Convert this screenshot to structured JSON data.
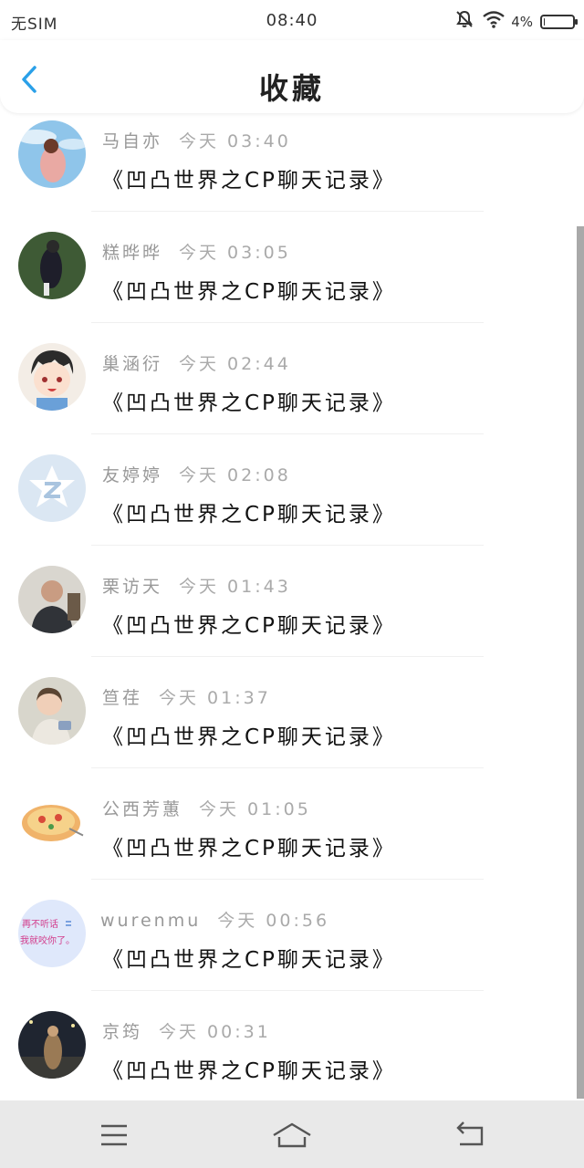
{
  "status_bar": {
    "carrier": "无SIM",
    "time": "08:40",
    "battery_text": "4%",
    "battery_level": 0.04
  },
  "header": {
    "title": "收藏",
    "accent_color": "#2aa0e8"
  },
  "items": [
    {
      "name": "马自亦",
      "time": "今天 03:40",
      "title": "《凹凸世界之CP聊天记录》",
      "avatar_icon": "avatar-photo-icon"
    },
    {
      "name": "糕晔晔",
      "time": "今天 03:05",
      "title": "《凹凸世界之CP聊天记录》",
      "avatar_icon": "avatar-photo-icon"
    },
    {
      "name": "巢涵衍",
      "time": "今天 02:44",
      "title": "《凹凸世界之CP聊天记录》",
      "avatar_icon": "avatar-cartoon-icon"
    },
    {
      "name": "友婷婷",
      "time": "今天 02:08",
      "title": "《凹凸世界之CP聊天记录》",
      "avatar_icon": "avatar-default-icon"
    },
    {
      "name": "栗访天",
      "time": "今天 01:43",
      "title": "《凹凸世界之CP聊天记录》",
      "avatar_icon": "avatar-photo-icon"
    },
    {
      "name": "笪荏",
      "time": "今天 01:37",
      "title": "《凹凸世界之CP聊天记录》",
      "avatar_icon": "avatar-photo-icon"
    },
    {
      "name": "公西芳蕙",
      "time": "今天 01:05",
      "title": "《凹凸世界之CP聊天记录》",
      "avatar_icon": "avatar-pizza-icon"
    },
    {
      "name": "wurenmu",
      "time": "今天 00:56",
      "title": "《凹凸世界之CP聊天记录》",
      "avatar_icon": "avatar-text-icon"
    },
    {
      "name": "京筠",
      "time": "今天 00:31",
      "title": "《凹凸世界之CP聊天记录》",
      "avatar_icon": "avatar-photo-icon"
    }
  ],
  "avatar_8_text": {
    "line1": "再不听话",
    "line2": "我就咬你了。"
  },
  "nav": {
    "icons": [
      "menu-icon",
      "home-icon",
      "back-icon"
    ]
  }
}
